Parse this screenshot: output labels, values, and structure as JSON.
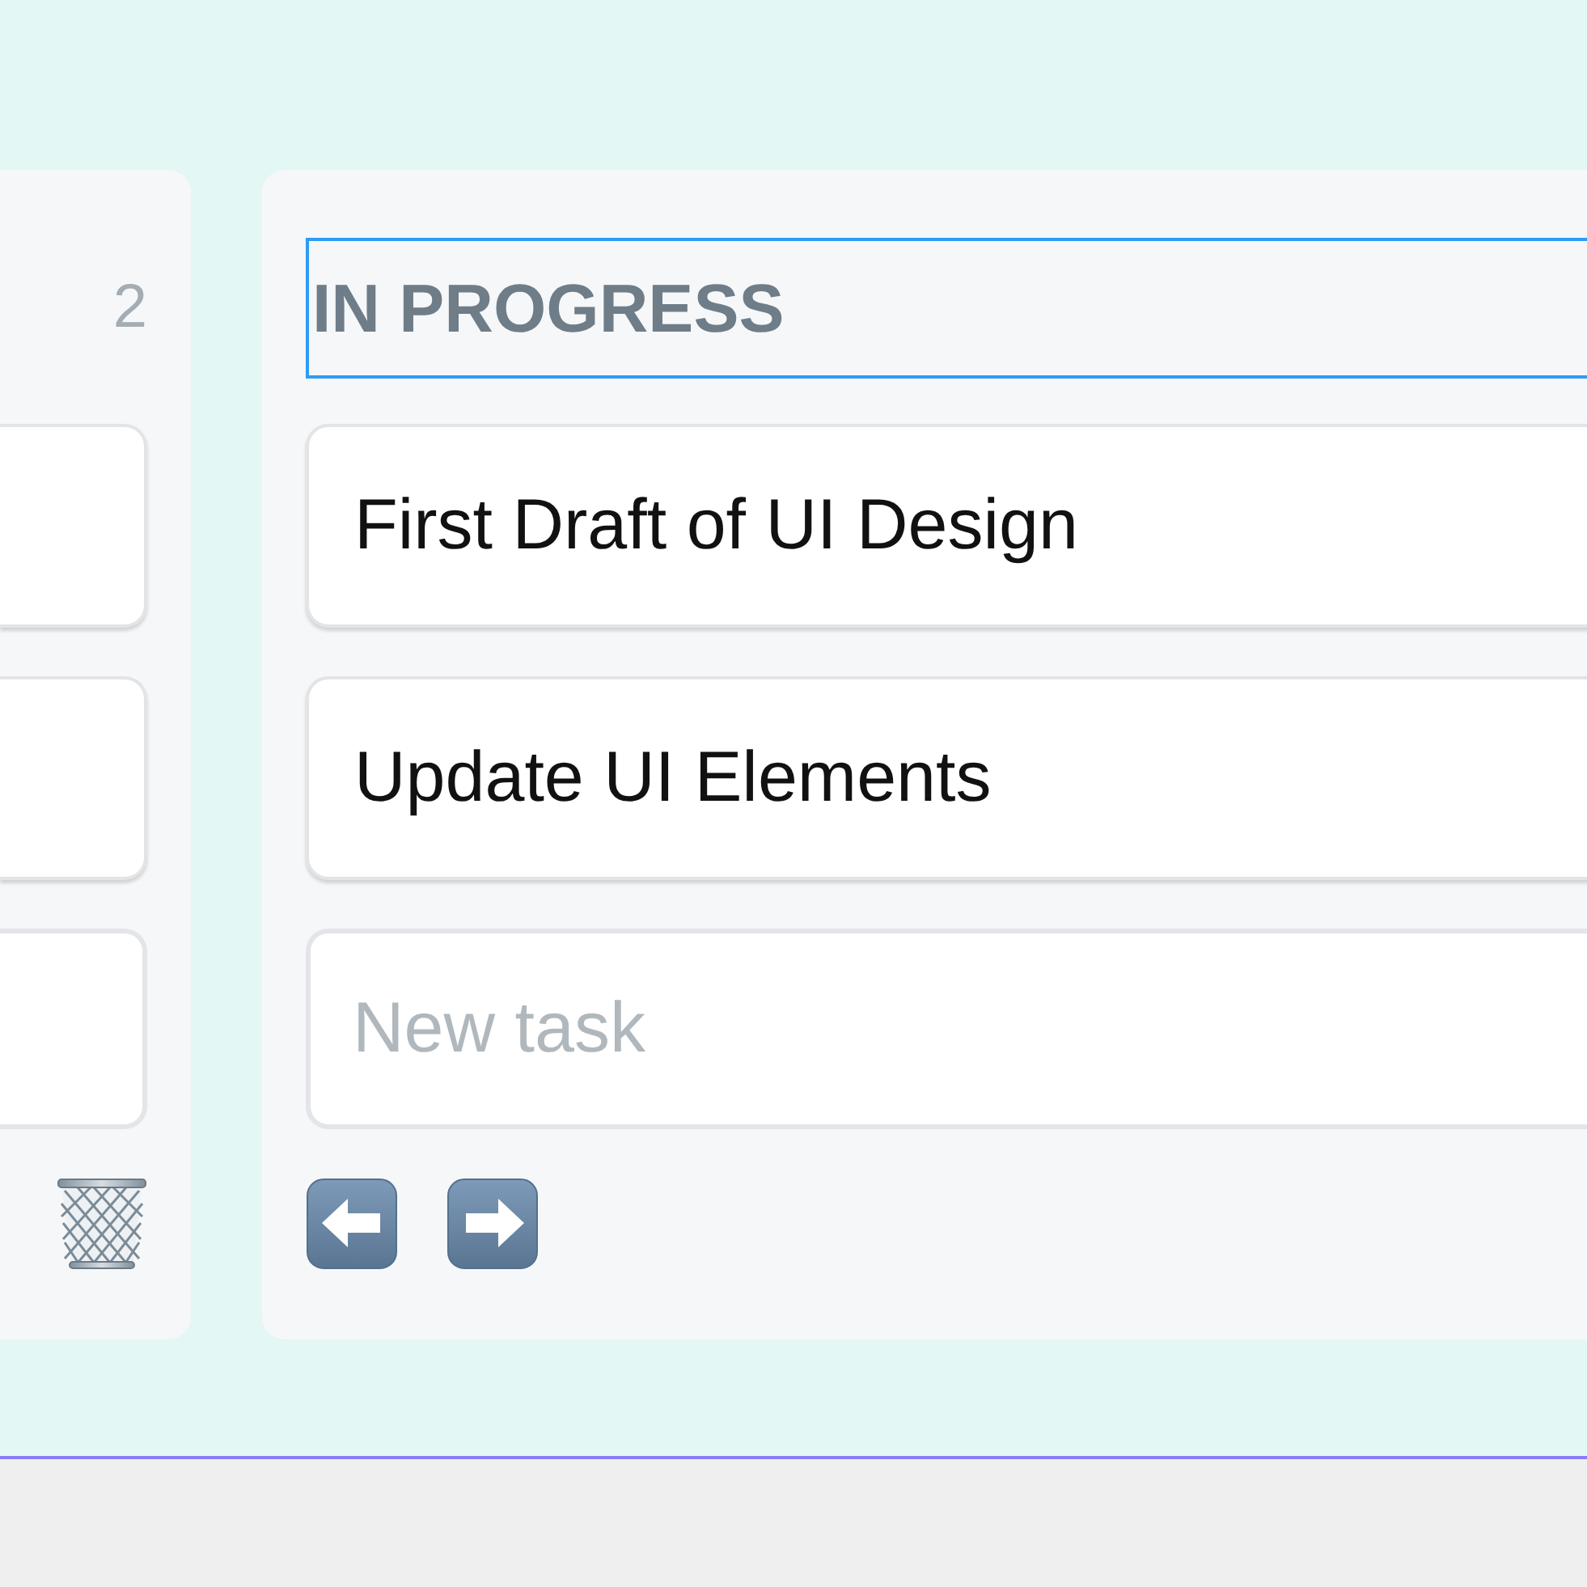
{
  "columns": [
    {
      "count": "2",
      "cards": [
        {
          "kind": "blank"
        },
        {
          "kind": "blank"
        }
      ],
      "new_task": {
        "kind": "blank"
      },
      "actions": [
        {
          "kind": "delete"
        }
      ]
    },
    {
      "title": "IN PROGRESS",
      "title_editing": true,
      "cards": [
        {
          "kind": "task",
          "text": "First Draft of UI Design"
        },
        {
          "kind": "task",
          "text": "Update UI Elements"
        }
      ],
      "new_task": {
        "kind": "field",
        "placeholder": "New task"
      },
      "actions": [
        {
          "kind": "move_left"
        },
        {
          "kind": "move_right"
        }
      ]
    }
  ]
}
